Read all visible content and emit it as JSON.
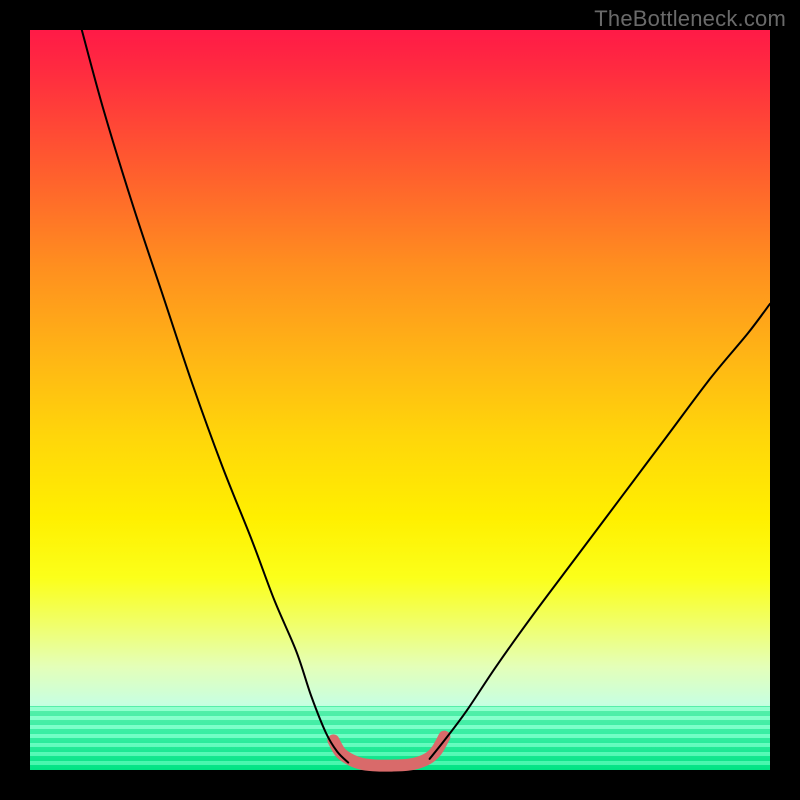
{
  "watermark": "TheBottleneck.com",
  "chart_data": {
    "type": "line",
    "title": "",
    "xlabel": "",
    "ylabel": "",
    "xlim": [
      0,
      100
    ],
    "ylim": [
      0,
      100
    ],
    "grid": false,
    "legend": false,
    "series": [
      {
        "name": "left-curve",
        "x": [
          7,
          10,
          14,
          18,
          22,
          26,
          30,
          33,
          36,
          38,
          40,
          41.5,
          43
        ],
        "values": [
          100,
          89,
          76,
          64,
          52,
          41,
          31,
          23,
          16,
          10,
          5,
          2.5,
          1
        ]
      },
      {
        "name": "valley-highlight",
        "x": [
          41,
          42,
          43.5,
          45,
          47,
          49,
          51,
          52.5,
          54,
          55,
          56
        ],
        "values": [
          4,
          2.3,
          1.3,
          0.8,
          0.6,
          0.6,
          0.7,
          1.0,
          1.7,
          2.7,
          4.5
        ]
      },
      {
        "name": "right-curve",
        "x": [
          54,
          56,
          59,
          63,
          68,
          74,
          80,
          86,
          92,
          97,
          100
        ],
        "values": [
          1.5,
          4,
          8,
          14,
          21,
          29,
          37,
          45,
          53,
          59,
          63
        ]
      }
    ],
    "series_styles": {
      "left-curve": {
        "color": "#000000",
        "width": 2
      },
      "right-curve": {
        "color": "#000000",
        "width": 2
      },
      "valley-highlight": {
        "color": "#d96a6a",
        "width": 12,
        "cap": "round"
      }
    },
    "background_gradient": {
      "top": "#ff1a47",
      "mid": "#fff000",
      "bottom": "#00e68a"
    }
  }
}
